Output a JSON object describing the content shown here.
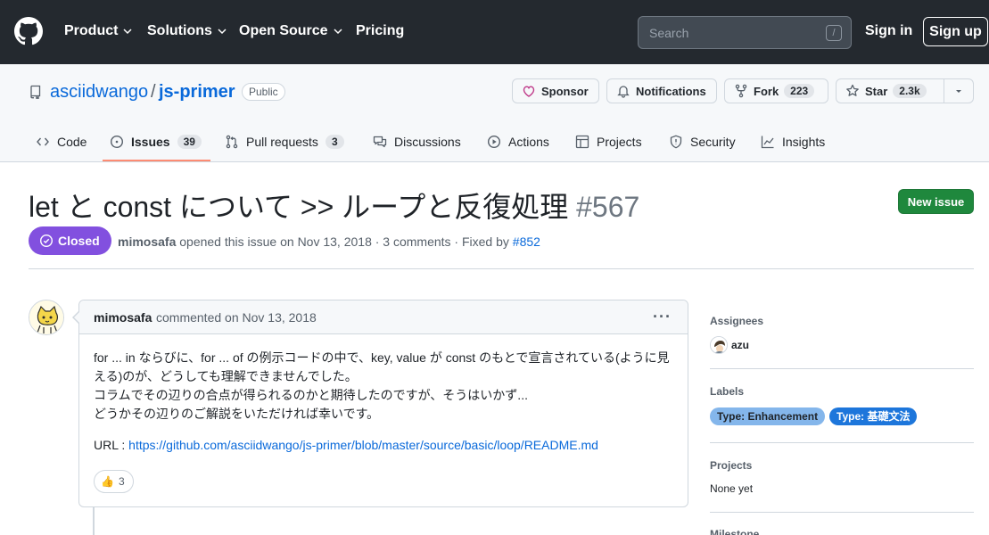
{
  "header": {
    "nav": [
      "Product",
      "Solutions",
      "Open Source",
      "Pricing"
    ],
    "search_placeholder": "Search",
    "search_shortcut": "/",
    "sign_in": "Sign in",
    "sign_up": "Sign up"
  },
  "repo": {
    "owner": "asciidwango",
    "separator": "/",
    "name": "js-primer",
    "visibility": "Public",
    "sponsor": "Sponsor",
    "notifications": "Notifications",
    "fork_label": "Fork",
    "fork_count": "223",
    "star_label": "Star",
    "star_count": "2.3k"
  },
  "tabs": [
    {
      "label": "Code",
      "icon": "code-icon"
    },
    {
      "label": "Issues",
      "count": "39",
      "icon": "issue-icon",
      "selected": true
    },
    {
      "label": "Pull requests",
      "count": "3",
      "icon": "pull-request-icon"
    },
    {
      "label": "Discussions",
      "icon": "discussions-icon"
    },
    {
      "label": "Actions",
      "icon": "play-icon"
    },
    {
      "label": "Projects",
      "icon": "table-icon"
    },
    {
      "label": "Security",
      "icon": "shield-icon"
    },
    {
      "label": "Insights",
      "icon": "graph-icon"
    }
  ],
  "issue": {
    "title": "let と const について >> ループと反復処理",
    "number": "#567",
    "new_issue": "New issue",
    "state": "Closed",
    "author": "mimosafa",
    "opened_text": "opened this issue on Nov 13, 2018 · 3 comments · Fixed by",
    "fixed_by": "#852"
  },
  "comment": {
    "author": "mimosafa",
    "date": "commented on Nov 13, 2018",
    "menu": "···",
    "body": [
      "for ... in ならびに、for ... of の例示コードの中で、key, value が const のもとで宣言されている(ように見える)のが、どうしても理解できませんでした。",
      "コラムでその辺りの合点が得られるのかと期待したのですが、そうはいかず...",
      "どうかその辺りのご解説をいただければ幸いです。"
    ],
    "url_label": "URL : ",
    "url": "https://github.com/asciidwango/js-primer/blob/master/source/basic/loop/README.md",
    "reaction_emoji": "👍",
    "reaction_count": "3"
  },
  "sidebar": {
    "assignees_heading": "Assignees",
    "assignee": "azu",
    "labels_heading": "Labels",
    "labels": [
      {
        "name": "Type: Enhancement",
        "bg": "#84b6eb",
        "fg": "#1f2328"
      },
      {
        "name": "Type: 基礎文法",
        "bg": "#1d76db",
        "fg": "#ffffff"
      }
    ],
    "projects_heading": "Projects",
    "projects_value": "None yet",
    "milestone_heading": "Milestone"
  },
  "colors": {
    "header_bg": "#24292f",
    "link": "#0969da",
    "closed": "#8250df",
    "new_issue": "#1f883d",
    "tab_underline": "#fd8c73"
  }
}
